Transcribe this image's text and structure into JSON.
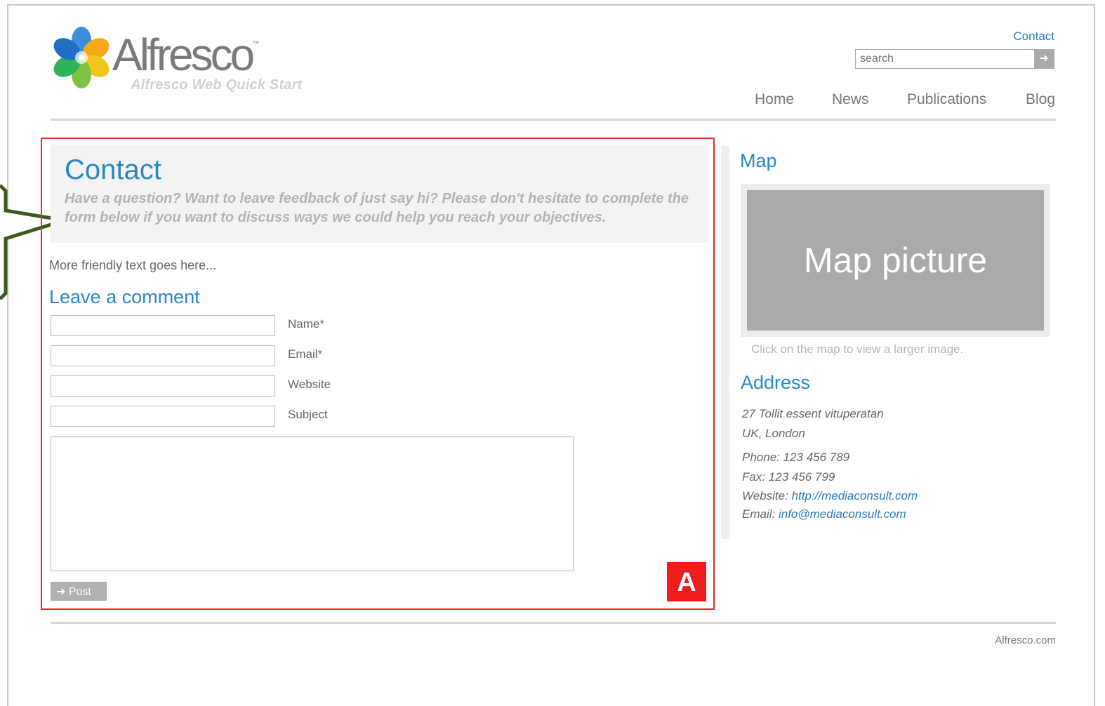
{
  "header": {
    "brand": "Alfresco",
    "brand_mark": "™",
    "tagline": "Alfresco Web Quick Start",
    "contact_link": "Contact",
    "search_placeholder": "search",
    "search_button_icon": "arrow-right-icon"
  },
  "nav": [
    "Home",
    "News",
    "Publications",
    "Blog"
  ],
  "main": {
    "title": "Contact",
    "intro": "Have a question? Want to leave feedback of just say hi? Please don't hesitate to complete the form below if you want to discuss ways we could help you reach your objectives.",
    "friendly_text": "More friendly text goes here...",
    "comment_heading": "Leave a comment",
    "fields": [
      {
        "label": "Name*",
        "value": ""
      },
      {
        "label": "Email*",
        "value": ""
      },
      {
        "label": "Website",
        "value": ""
      },
      {
        "label": "Subject",
        "value": ""
      }
    ],
    "message_value": "",
    "post_label": "Post",
    "badge": "A"
  },
  "sidebar": {
    "map_heading": "Map",
    "map_placeholder": "Map picture",
    "map_caption": "Click on the map to view a larger image.",
    "address_heading": "Address",
    "address": [
      "27 Tollit essent vituperatan",
      "UK, London"
    ],
    "phone": "Phone: 123 456 789",
    "fax": "Fax: 123 456 799",
    "website_label": "Website:",
    "website_url": "http://mediaconsult.com",
    "email_label": "Email:",
    "email": "info@mediaconsult.com"
  },
  "footer": {
    "link": "Alfresco.com"
  },
  "colors": {
    "accent": "#2a86c4",
    "highlight": "#e52b2b",
    "callout": "#3d5a1e"
  }
}
